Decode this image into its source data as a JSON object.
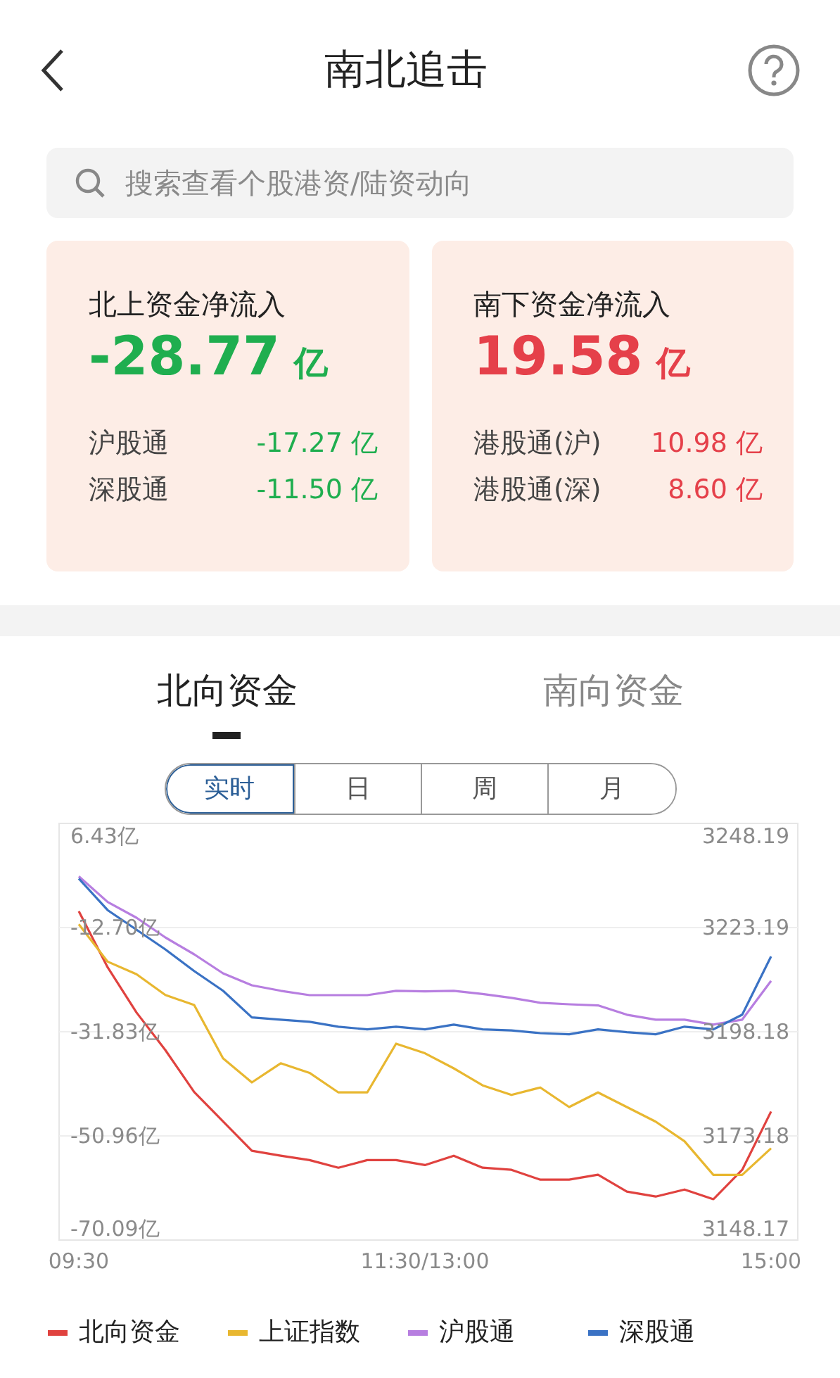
{
  "header": {
    "title": "南北追击"
  },
  "search": {
    "placeholder": "搜索查看个股港资/陆资动向"
  },
  "summary_cards": [
    {
      "title": "北上资金净流入",
      "value": "-28.77",
      "unit": "亿",
      "color": "#1fae4f",
      "rows": [
        {
          "label": "沪股通",
          "value": "-17.27 亿"
        },
        {
          "label": "深股通",
          "value": "-11.50 亿"
        }
      ]
    },
    {
      "title": "南下资金净流入",
      "value": "19.58",
      "unit": "亿",
      "color": "#e5404a",
      "rows": [
        {
          "label": "港股通(沪)",
          "value": "10.98 亿"
        },
        {
          "label": "港股通(深)",
          "value": "8.60 亿"
        }
      ]
    }
  ],
  "tabs": [
    {
      "label": "北向资金",
      "selected": true
    },
    {
      "label": "南向资金",
      "selected": false
    }
  ],
  "periods": [
    {
      "label": "实时",
      "selected": true
    },
    {
      "label": "日",
      "selected": false
    },
    {
      "label": "周",
      "selected": false
    },
    {
      "label": "月",
      "selected": false
    }
  ],
  "chart": {
    "chart_data": {
      "type": "line",
      "categories": [
        "09:30",
        null,
        null,
        null,
        null,
        null,
        null,
        null,
        null,
        null,
        null,
        null,
        "11:30/13:00",
        null,
        null,
        null,
        null,
        null,
        null,
        null,
        null,
        null,
        null,
        null,
        "15:00"
      ],
      "grid": true,
      "ylim": [
        -70.09,
        6.43
      ],
      "yticks": [
        {
          "value": 6.43,
          "label": "6.43亿"
        },
        {
          "value": -12.7,
          "label": "-12.70亿"
        },
        {
          "value": -31.83,
          "label": "-31.83亿"
        },
        {
          "value": -50.96,
          "label": "-50.96亿"
        },
        {
          "value": -70.09,
          "label": "-70.09亿"
        }
      ],
      "y2lim": [
        3148.17,
        3248.19
      ],
      "y2ticks": [
        {
          "value": 3248.19,
          "label": "3248.19"
        },
        {
          "value": 3223.19,
          "label": "3223.19"
        },
        {
          "value": 3198.18,
          "label": "3198.18"
        },
        {
          "value": 3173.18,
          "label": "3173.18"
        },
        {
          "value": 3148.17,
          "label": "3148.17"
        }
      ],
      "series": [
        {
          "name": "北向资金",
          "color": "#e0423f",
          "values": [
            -9.7,
            -20,
            -28.3,
            -35.2,
            -42.9,
            -48.3,
            -53.7,
            -54.6,
            -55.4,
            -56.8,
            -55.4,
            -55.4,
            -56.3,
            -54.6,
            -56.8,
            -57.2,
            -59,
            -59,
            -58.1,
            -61.2,
            -62.1,
            -60.8,
            -62.6,
            -57.2,
            -46.5
          ]
        },
        {
          "name": "上证指数",
          "color": "#e8b730",
          "axis": "y2",
          "values": [
            3224,
            3215,
            3212,
            3207,
            3204.6,
            3191.8,
            3186,
            3190.6,
            3188.3,
            3183.6,
            3183.6,
            3195.3,
            3193,
            3189.4,
            3185.3,
            3183,
            3184.8,
            3180.1,
            3183.6,
            3180.1,
            3176.6,
            3171.9,
            3163.8,
            3163.8,
            3170.2
          ]
        },
        {
          "name": "沪股通",
          "color": "#b77ee0",
          "values": [
            -3.3,
            -8,
            -10.9,
            -14.5,
            -17.6,
            -21.1,
            -23.3,
            -24.3,
            -25.1,
            -25.1,
            -25.1,
            -24.3,
            -24.4,
            -24.3,
            -24.9,
            -25.6,
            -26.5,
            -26.8,
            -27,
            -28.7,
            -29.6,
            -29.6,
            -30.5,
            -29.6,
            -22.5
          ]
        },
        {
          "name": "深股通",
          "color": "#3a72c4",
          "values": [
            -3.7,
            -9.5,
            -13.1,
            -16.7,
            -20.7,
            -24.3,
            -29.2,
            -29.6,
            -30,
            -30.9,
            -31.4,
            -30.9,
            -31.4,
            -30.5,
            -31.4,
            -31.6,
            -32.1,
            -32.3,
            -31.4,
            -31.9,
            -32.3,
            -30.9,
            -31.4,
            -28.7,
            -18
          ]
        }
      ]
    }
  }
}
